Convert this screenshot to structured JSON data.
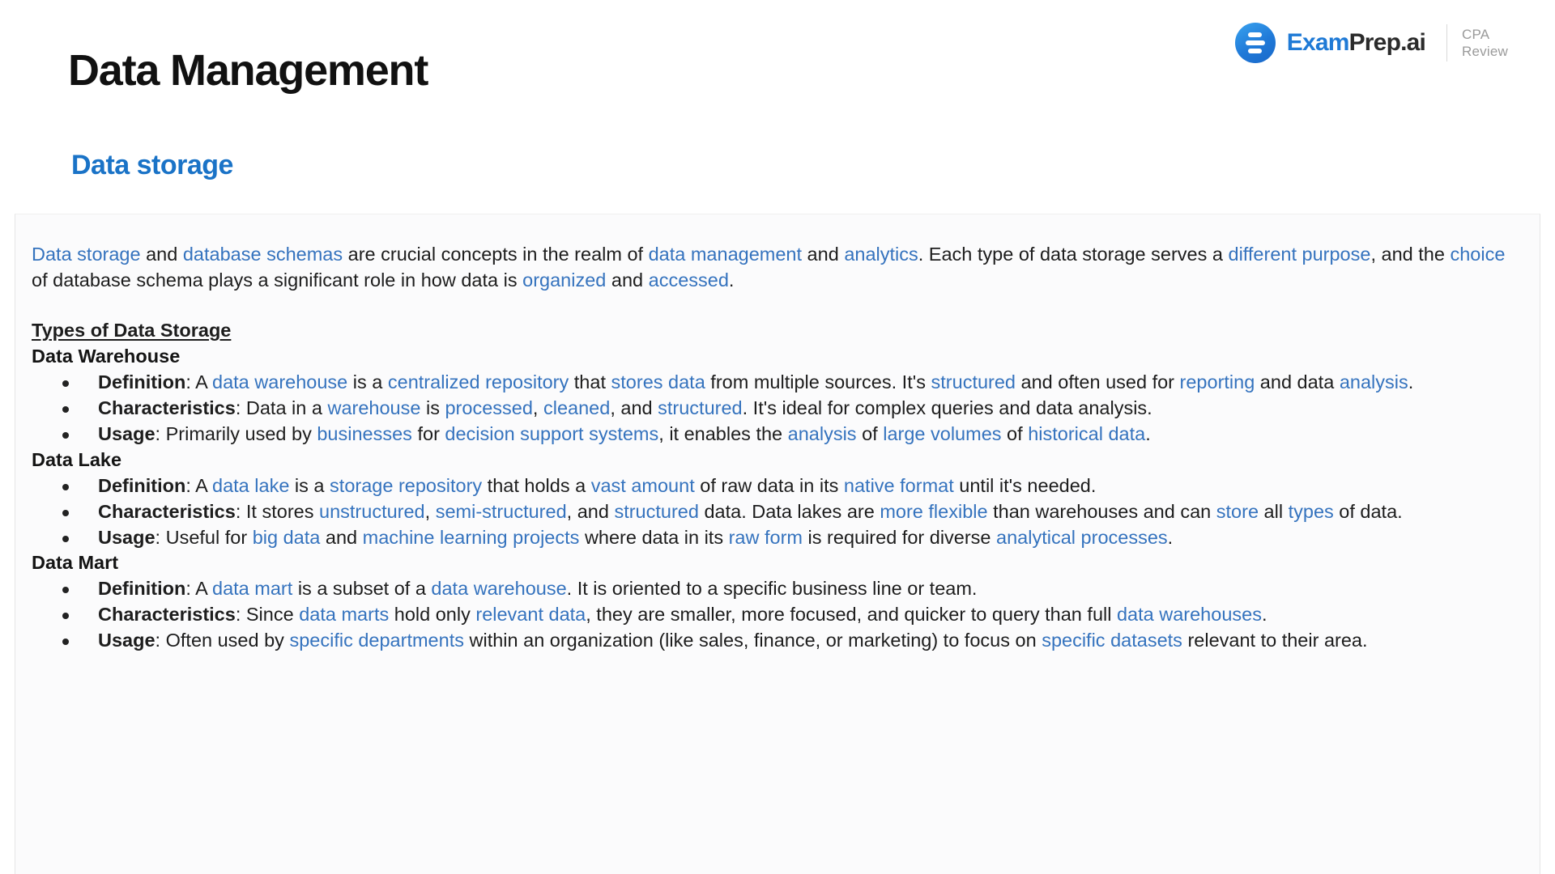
{
  "header": {
    "page_title": "Data Management",
    "section_title": "Data storage",
    "accent_blue": "#1a73c7",
    "link_blue": "#3573be"
  },
  "brand": {
    "icon": "examprep-logo-icon",
    "word_primary": "Exam",
    "word_secondary": "Prep.ai",
    "sub_line1": "CPA",
    "sub_line2": "Review"
  },
  "intro": {
    "line1_parts": [
      {
        "t": "Data storage",
        "link": true
      },
      {
        "t": " and ",
        "link": false
      },
      {
        "t": "database schemas",
        "link": true
      },
      {
        "t": " are crucial concepts in the realm of ",
        "link": false
      },
      {
        "t": "data management",
        "link": true
      },
      {
        "t": " and ",
        "link": false
      },
      {
        "t": "analytics",
        "link": true
      },
      {
        "t": ". Each type of data storage serves a ",
        "link": false
      },
      {
        "t": "different purpose",
        "link": true
      },
      {
        "t": ", and the ",
        "link": false
      },
      {
        "t": "choice",
        "link": true
      },
      {
        "t": " of database schema plays a significant role in how data is ",
        "link": false
      },
      {
        "t": "organized",
        "link": true
      },
      {
        "t": " and ",
        "link": false
      },
      {
        "t": "accessed",
        "link": true
      },
      {
        "t": ".",
        "link": false
      }
    ]
  },
  "types_heading": "Types of Data Storage",
  "sections": [
    {
      "name": "Data Warehouse",
      "bullets": [
        {
          "label": "Definition",
          "parts": [
            {
              "t": ": A ",
              "link": false
            },
            {
              "t": "data warehouse",
              "link": true
            },
            {
              "t": " is a ",
              "link": false
            },
            {
              "t": "centralized repository",
              "link": true
            },
            {
              "t": " that ",
              "link": false
            },
            {
              "t": "stores data",
              "link": true
            },
            {
              "t": " from multiple sources. It's ",
              "link": false
            },
            {
              "t": "structured",
              "link": true
            },
            {
              "t": " and often used for ",
              "link": false
            },
            {
              "t": "reporting",
              "link": true
            },
            {
              "t": " and data ",
              "link": false
            },
            {
              "t": "analysis",
              "link": true
            },
            {
              "t": ".",
              "link": false
            }
          ]
        },
        {
          "label": "Characteristics",
          "parts": [
            {
              "t": ": Data in a ",
              "link": false
            },
            {
              "t": "warehouse",
              "link": true
            },
            {
              "t": " is ",
              "link": false
            },
            {
              "t": "processed",
              "link": true
            },
            {
              "t": ", ",
              "link": false
            },
            {
              "t": "cleaned",
              "link": true
            },
            {
              "t": ", and ",
              "link": false
            },
            {
              "t": "structured",
              "link": true
            },
            {
              "t": ". It's ideal for complex queries and data analysis.",
              "link": false
            }
          ]
        },
        {
          "label": "Usage",
          "parts": [
            {
              "t": ": Primarily used by ",
              "link": false
            },
            {
              "t": "businesses",
              "link": true
            },
            {
              "t": " for ",
              "link": false
            },
            {
              "t": "decision support systems",
              "link": true
            },
            {
              "t": ", it enables the ",
              "link": false
            },
            {
              "t": "analysis",
              "link": true
            },
            {
              "t": " of ",
              "link": false
            },
            {
              "t": "large volumes",
              "link": true
            },
            {
              "t": " of ",
              "link": false
            },
            {
              "t": "historical data",
              "link": true
            },
            {
              "t": ".",
              "link": false
            }
          ]
        }
      ]
    },
    {
      "name": "Data Lake",
      "bullets": [
        {
          "label": "Definition",
          "parts": [
            {
              "t": ": A ",
              "link": false
            },
            {
              "t": "data lake",
              "link": true
            },
            {
              "t": " is a ",
              "link": false
            },
            {
              "t": "storage repository",
              "link": true
            },
            {
              "t": " that holds a ",
              "link": false
            },
            {
              "t": "vast amount",
              "link": true
            },
            {
              "t": " of raw data in its ",
              "link": false
            },
            {
              "t": "native format",
              "link": true
            },
            {
              "t": " until it's needed.",
              "link": false
            }
          ]
        },
        {
          "label": "Characteristics",
          "parts": [
            {
              "t": ": It stores ",
              "link": false
            },
            {
              "t": "unstructured",
              "link": true
            },
            {
              "t": ", ",
              "link": false
            },
            {
              "t": "semi-structured",
              "link": true
            },
            {
              "t": ", and ",
              "link": false
            },
            {
              "t": "structured",
              "link": true
            },
            {
              "t": " data. Data lakes are ",
              "link": false
            },
            {
              "t": "more flexible",
              "link": true
            },
            {
              "t": " than warehouses and can ",
              "link": false
            },
            {
              "t": "store",
              "link": true
            },
            {
              "t": " all ",
              "link": false
            },
            {
              "t": "types",
              "link": true
            },
            {
              "t": " of data.",
              "link": false
            }
          ]
        },
        {
          "label": "Usage",
          "parts": [
            {
              "t": ": Useful for ",
              "link": false
            },
            {
              "t": "big data",
              "link": true
            },
            {
              "t": " and ",
              "link": false
            },
            {
              "t": "machine learning projects",
              "link": true
            },
            {
              "t": " where data in its ",
              "link": false
            },
            {
              "t": "raw form",
              "link": true
            },
            {
              "t": " is required for diverse ",
              "link": false
            },
            {
              "t": "analytical processes",
              "link": true
            },
            {
              "t": ".",
              "link": false
            }
          ]
        }
      ]
    },
    {
      "name": "Data Mart",
      "bullets": [
        {
          "label": "Definition",
          "parts": [
            {
              "t": ": A ",
              "link": false
            },
            {
              "t": "data mart",
              "link": true
            },
            {
              "t": " is a subset of a ",
              "link": false
            },
            {
              "t": "data warehouse",
              "link": true
            },
            {
              "t": ". It is oriented to a specific business line or team.",
              "link": false
            }
          ]
        },
        {
          "label": "Characteristics",
          "parts": [
            {
              "t": ": Since ",
              "link": false
            },
            {
              "t": "data marts",
              "link": true
            },
            {
              "t": " hold only ",
              "link": false
            },
            {
              "t": "relevant data",
              "link": true
            },
            {
              "t": ", they are smaller, more focused, and quicker to query than full ",
              "link": false
            },
            {
              "t": "data warehouses",
              "link": true
            },
            {
              "t": ".",
              "link": false
            }
          ]
        },
        {
          "label": "Usage",
          "parts": [
            {
              "t": ": Often used by ",
              "link": false
            },
            {
              "t": "specific departments",
              "link": true
            },
            {
              "t": " within an organization (like sales, finance, or marketing) to focus on ",
              "link": false
            },
            {
              "t": "specific datasets",
              "link": true
            },
            {
              "t": " relevant to their area.",
              "link": false
            }
          ]
        }
      ]
    }
  ]
}
